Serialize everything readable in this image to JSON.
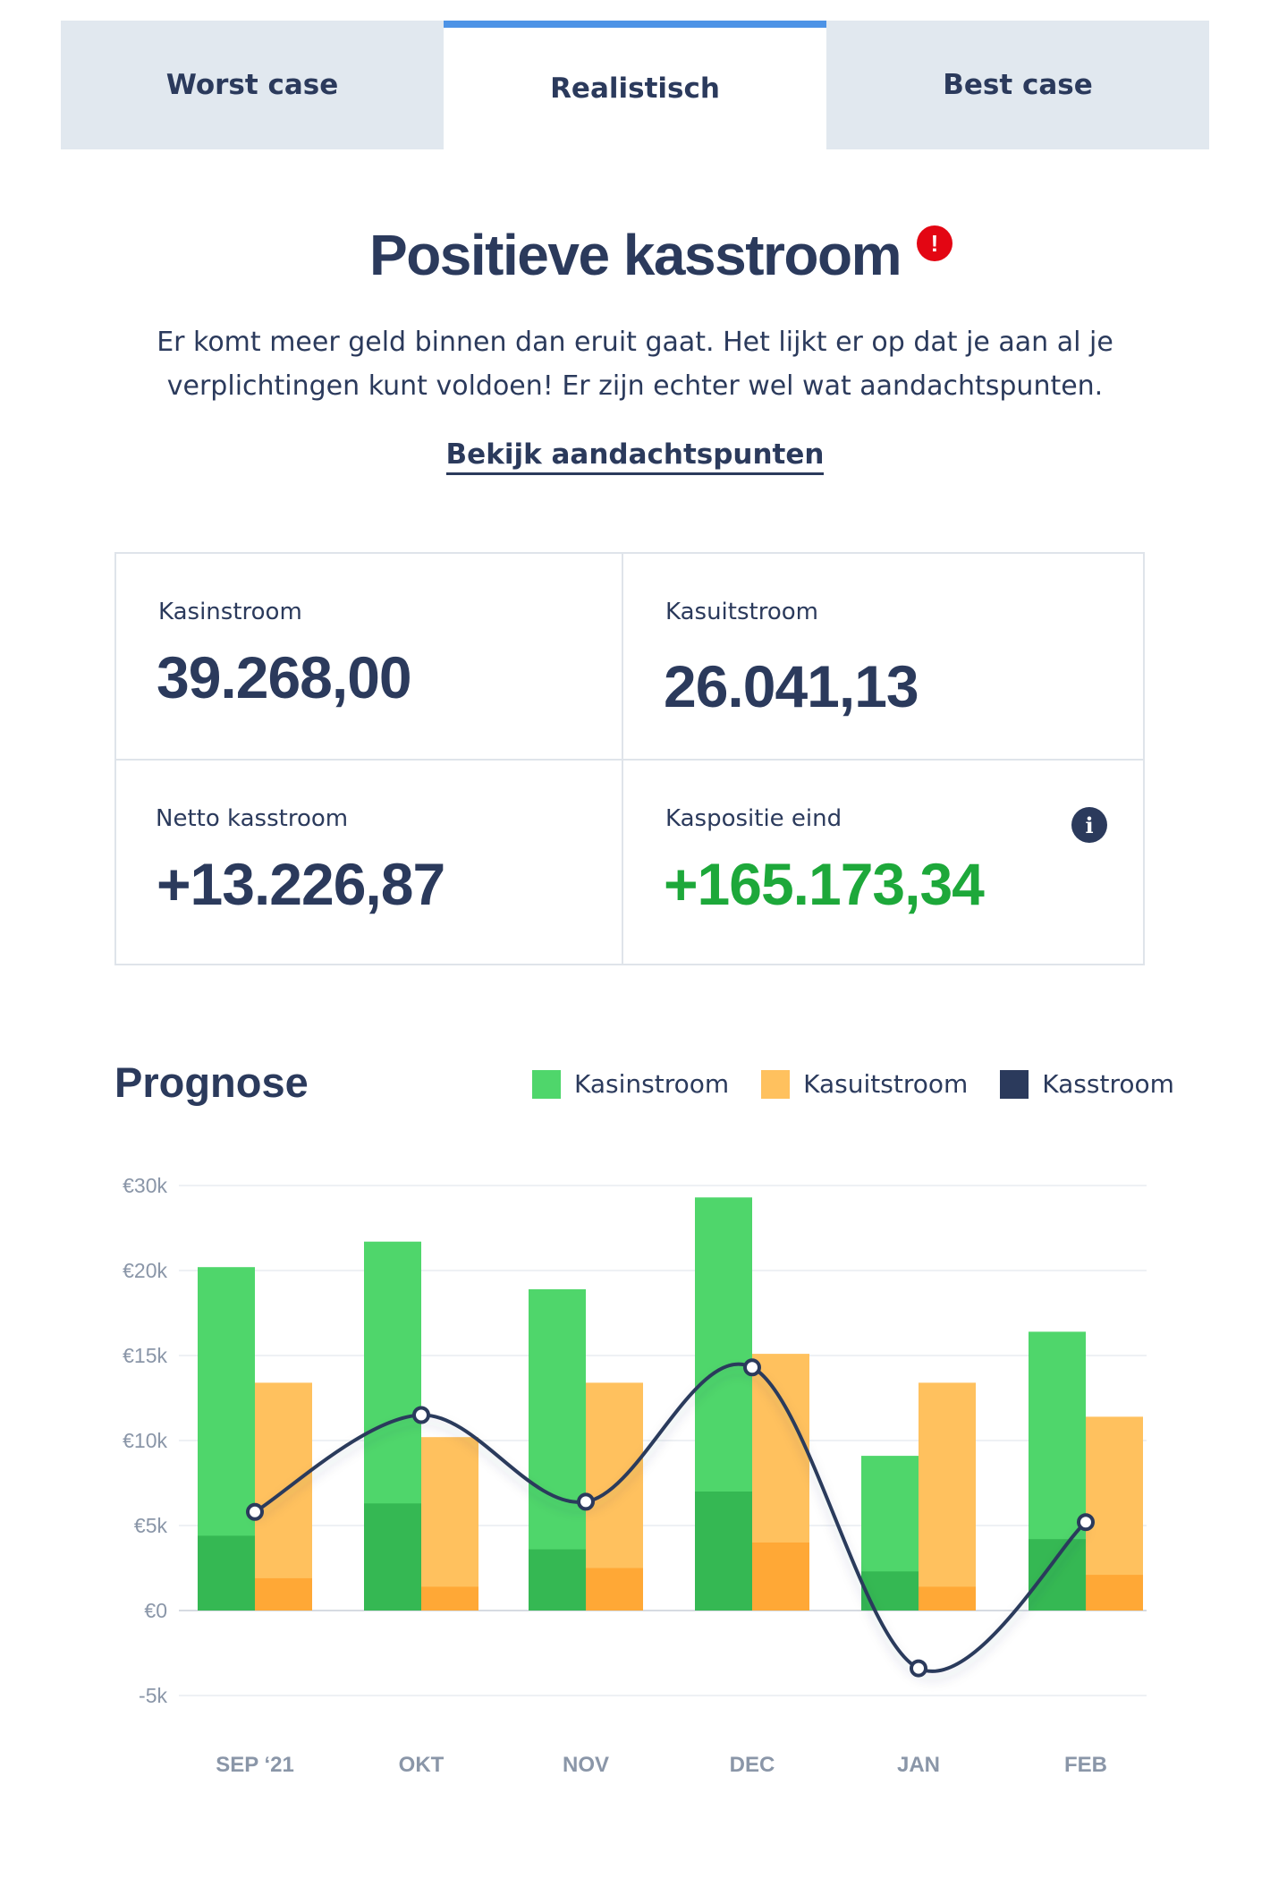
{
  "tabs": [
    {
      "label": "Worst case",
      "active": false
    },
    {
      "label": "Realistisch",
      "active": true
    },
    {
      "label": "Best case",
      "active": false
    }
  ],
  "headline": "Positieve kasstroom",
  "alert_icon": "exclamation-icon",
  "lead": "Er komt meer geld binnen dan eruit gaat. Het lijkt er op dat je aan al je verplichtingen kunt voldoen! Er zijn echter wel wat aandachtspunten.",
  "link_label": "Bekijk aandachtspunten",
  "kpis": {
    "inflow": {
      "label": "Kasinstroom",
      "value": "39.268,00"
    },
    "outflow": {
      "label": "Kasuitstroom",
      "value": "26.041,13"
    },
    "net": {
      "label": "Netto kasstroom",
      "value": "+13.226,87"
    },
    "position": {
      "label": "Kaspositie eind",
      "value": "+165.173,34",
      "info_icon": "info-icon"
    }
  },
  "colors": {
    "inflow": "#4fd66b",
    "inflow_dark": "#35b853",
    "outflow": "#ffc15e",
    "outflow_dark": "#ffa836",
    "cashflow": "#2b3a5c",
    "accent": "#4d93e6",
    "positive": "#1da83a",
    "alert": "#e30613"
  },
  "chart_title": "Prognose",
  "legend": [
    {
      "label": "Kasinstroom",
      "color": "#4fd66b"
    },
    {
      "label": "Kasuitstroom",
      "color": "#ffc15e"
    },
    {
      "label": "Kasstroom",
      "color": "#2b3a5c"
    }
  ],
  "chart_data": {
    "type": "bar",
    "categories": [
      "SEP ‘21",
      "OKT",
      "NOV",
      "DEC",
      "JAN",
      "FEB"
    ],
    "y_tick_labels": [
      "€30k",
      "€20k",
      "€15k",
      "€10k",
      "€5k",
      "€0",
      "-5k"
    ],
    "y_tick_values": [
      25000,
      20000,
      15000,
      10000,
      5000,
      0,
      -5000
    ],
    "ylim": [
      -5000,
      25000
    ],
    "grid": true,
    "legend_position": "top-right",
    "series": [
      {
        "name": "Kasinstroom",
        "values": [
          20200,
          21700,
          18900,
          24300,
          9100,
          16400
        ],
        "dark_values": [
          4400,
          6300,
          3600,
          7000,
          2300,
          4200
        ]
      },
      {
        "name": "Kasuitstroom",
        "values": [
          13400,
          10200,
          13400,
          15100,
          13400,
          11400
        ],
        "dark_values": [
          1900,
          1400,
          2500,
          4000,
          1400,
          2100
        ]
      },
      {
        "name": "Kasstroom",
        "type": "line",
        "values": [
          5800,
          11500,
          6400,
          14300,
          -3400,
          5200
        ]
      }
    ]
  }
}
